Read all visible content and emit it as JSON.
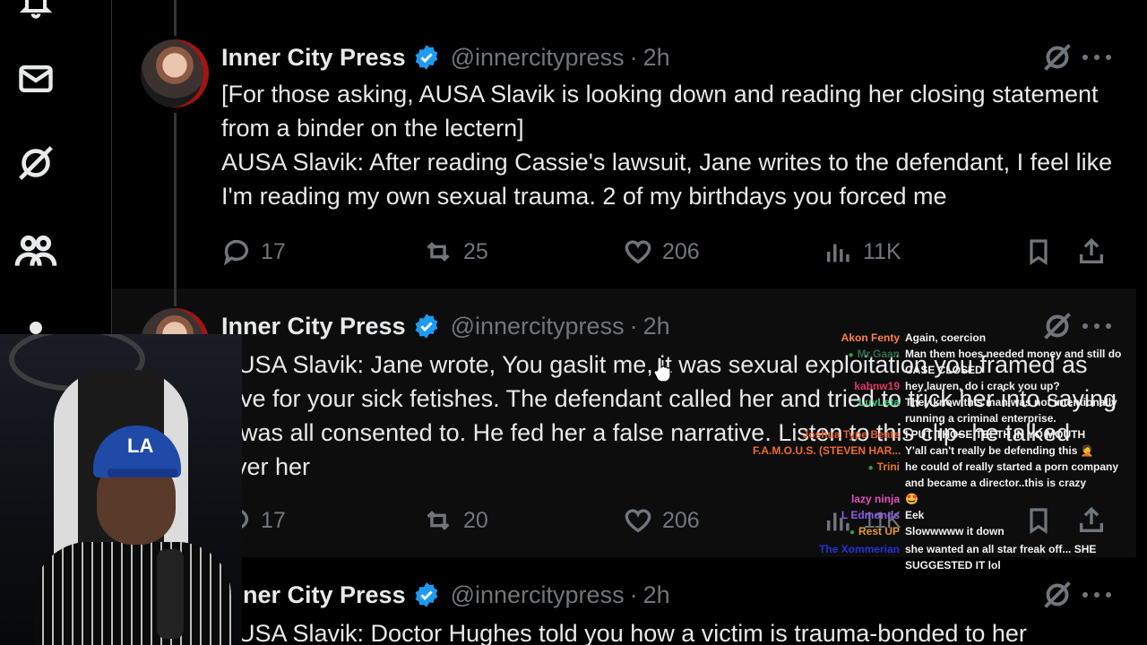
{
  "nav": {
    "items": [
      "notifications-icon",
      "messages-icon",
      "grok-icon",
      "communities-icon",
      "profile-icon"
    ]
  },
  "posts": [
    {
      "name": "Inner City Press",
      "handle": "@innercitypress",
      "time": "2h",
      "body": [
        "[For those asking, AUSA Slavik is looking down and reading her closing statement from a binder on the lectern]",
        "AUSA Slavik: After reading Cassie's lawsuit, Jane writes to the defendant, I feel like I'm reading my own sexual trauma. 2 of my birthdays you forced me"
      ],
      "replies": "17",
      "reposts": "25",
      "likes": "206",
      "views": "11K"
    },
    {
      "name": "Inner City Press",
      "handle": "@innercitypress",
      "time": "2h",
      "body": [
        "AUSA Slavik: Jane wrote, You gaslit me, it was sexual exploitation you framed as love for your sick fetishes. The defendant called her and tried to trick her into saying it was all consented to. He fed her a false narrative. Listen to this clip- he talked over her"
      ],
      "replies": "17",
      "reposts": "20",
      "likes": "206",
      "views": "11K"
    },
    {
      "name": "Inner City Press",
      "handle": "@innercitypress",
      "time": "2h",
      "body": [
        "AUSA Slavik: Doctor Hughes told you how a victim is trauma-bonded to her"
      ]
    }
  ],
  "chat": [
    {
      "user": "Akon Fenty",
      "color": "#ff7f3f",
      "badge": false,
      "text": "Again, coercion"
    },
    {
      "user": "Mr.Gaan",
      "color": "#2f6e49",
      "badge": true,
      "text": "Man them hoes needed money and still do CASE CLOSED"
    },
    {
      "user": "kabnw19",
      "color": "#e0356a",
      "badge": false,
      "text": "hey lauren, do i crack you up?"
    },
    {
      "user": "LuvLeta",
      "color": "#47c47a",
      "badge": false,
      "text": "They know this man was not intentionally running a criminal enterprise."
    },
    {
      "user": "Joshua Type Beats",
      "color": "#e35d2f",
      "badge": false,
      "text": "I PUT THOSE TEETH IN YO MOUTH"
    },
    {
      "user": "F.A.M.O.U.S. (STEVEN HAR...",
      "color": "#f06c2b",
      "badge": false,
      "text": "Y'all can't really be defending this 🤦"
    },
    {
      "user": "Trini",
      "color": "#e57a2b",
      "badge": true,
      "text": "he could of really started a porn company and became a director..this is crazy"
    },
    {
      "user": "lazy ninja",
      "color": "#e052b8",
      "badge": false,
      "text": "🤩"
    },
    {
      "user": "L Edmonds",
      "color": "#8a5ce6",
      "badge": false,
      "text": "Eek"
    },
    {
      "user": "Rest UP",
      "color": "#e59a2b",
      "badge": true,
      "text": "Slowwwww it down"
    },
    {
      "user": "The Xommerian",
      "color": "#2433d8",
      "badge": false,
      "text": "she wanted an all star freak off... SHE SUGGESTED IT lol"
    }
  ],
  "colors": {
    "verified": "#1d9bf0",
    "muted": "#71767b",
    "text": "#e7e9ea"
  }
}
